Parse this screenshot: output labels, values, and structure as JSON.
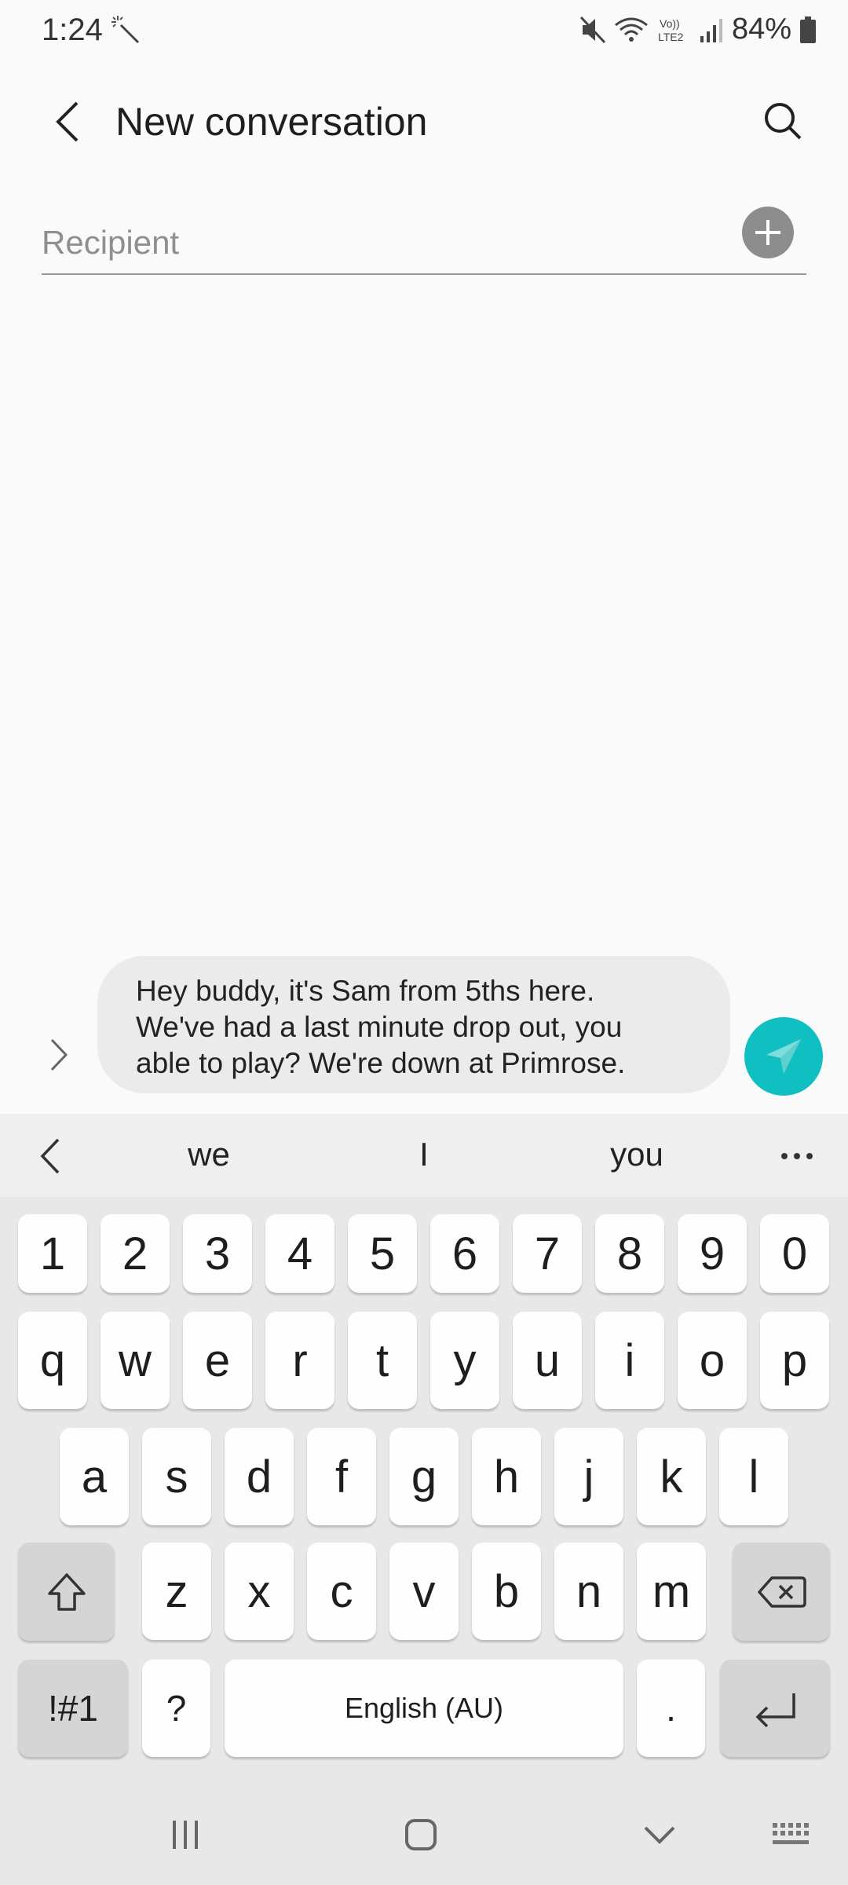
{
  "status_bar": {
    "time": "1:24",
    "battery": "84%"
  },
  "header": {
    "title": "New conversation"
  },
  "recipient": {
    "placeholder": "Recipient"
  },
  "composer": {
    "message_lines": [
      "Hey buddy, it's Sam from 5ths here.",
      "We've had a last minute drop out, you",
      "able to play? We're down at Primrose."
    ]
  },
  "keyboard": {
    "suggestions": [
      "we",
      "I",
      "you"
    ],
    "number_row": [
      "1",
      "2",
      "3",
      "4",
      "5",
      "6",
      "7",
      "8",
      "9",
      "0"
    ],
    "row1": [
      "q",
      "w",
      "e",
      "r",
      "t",
      "y",
      "u",
      "i",
      "o",
      "p"
    ],
    "row2": [
      "a",
      "s",
      "d",
      "f",
      "g",
      "h",
      "j",
      "k",
      "l"
    ],
    "row3": [
      "z",
      "x",
      "c",
      "v",
      "b",
      "n",
      "m"
    ],
    "symbols_label": "!#1",
    "question_label": "?",
    "space_label": "English (AU)",
    "period_label": "."
  },
  "colors": {
    "accent": "#10bfc1",
    "background": "#fafafa",
    "keyboard_bg": "#e8e8e8"
  }
}
